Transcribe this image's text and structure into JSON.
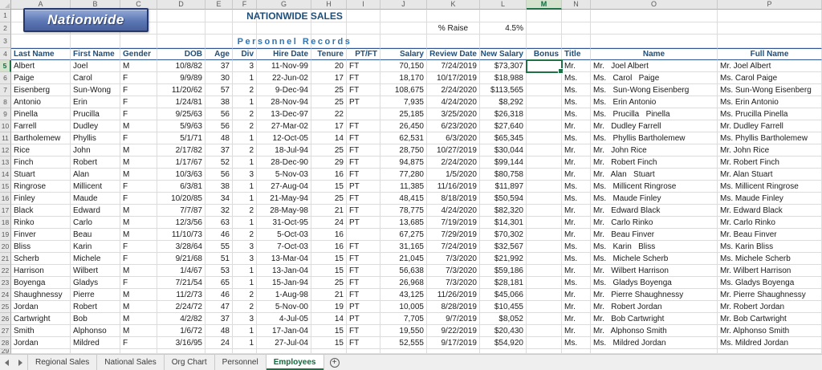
{
  "grid": {
    "column_letters": [
      "A",
      "B",
      "C",
      "D",
      "E",
      "F",
      "G",
      "H",
      "I",
      "J",
      "K",
      "L",
      "M",
      "N",
      "O",
      "P"
    ],
    "selected": {
      "cell": "M5",
      "column": "M",
      "row": 5
    },
    "first_visible_row": 1,
    "last_visible_row": 28
  },
  "workbook": {
    "logo_text": "Nationwide",
    "title": "NATIONWIDE SALES",
    "raise_label": "% Raise",
    "raise_value": "4.5%",
    "section_title": "Personnel Records"
  },
  "table": {
    "headers": [
      "Last Name",
      "First Name",
      "Gender",
      "DOB",
      "Age",
      "Div",
      "Hire Date",
      "Tenure",
      "PT/FT",
      "Salary",
      "Review Date",
      "New Salary",
      "Bonus",
      "Title",
      "Name",
      "Full Name"
    ],
    "rows": [
      [
        "Albert",
        "Joel",
        "M",
        "10/8/82",
        "37",
        "3",
        "11-Nov-99",
        "20",
        "FT",
        "70,150",
        "7/24/2019",
        "$73,307",
        "",
        "Mr.",
        "Mr.   Joel Albert",
        "Mr. Joel Albert"
      ],
      [
        "Paige",
        "Carol",
        "F",
        "9/9/89",
        "30",
        "1",
        "22-Jun-02",
        "17",
        "FT",
        "18,170",
        "10/17/2019",
        "$18,988",
        "",
        "Ms.",
        "Ms.   Carol   Paige",
        "Ms. Carol Paige"
      ],
      [
        "Eisenberg",
        "Sun-Wong",
        "F",
        "11/20/62",
        "57",
        "2",
        "9-Dec-94",
        "25",
        "FT",
        "108,675",
        "2/24/2020",
        "$113,565",
        "",
        "Ms.",
        "Ms.   Sun-Wong Eisenberg",
        "Ms. Sun-Wong Eisenberg"
      ],
      [
        "Antonio",
        "Erin",
        "F",
        "1/24/81",
        "38",
        "1",
        "28-Nov-94",
        "25",
        "PT",
        "7,935",
        "4/24/2020",
        "$8,292",
        "",
        "Ms.",
        "Ms.   Erin Antonio",
        "Ms. Erin Antonio"
      ],
      [
        "Pinella",
        "Prucilla",
        "F",
        "9/25/63",
        "56",
        "2",
        "13-Dec-97",
        "22",
        "",
        "25,185",
        "3/25/2020",
        "$26,318",
        "",
        "Ms.",
        "Ms.   Prucilla   Pinella",
        "Ms. Prucilla Pinella"
      ],
      [
        "Farrell",
        "Dudley",
        "M",
        "5/9/63",
        "56",
        "2",
        "27-Mar-02",
        "17",
        "FT",
        "26,450",
        "6/23/2020",
        "$27,640",
        "",
        "Mr.",
        "Mr.   Dudley Farrell",
        "Mr. Dudley Farrell"
      ],
      [
        "Bartholemew",
        "Phyllis",
        "F",
        "5/1/71",
        "48",
        "1",
        "12-Oct-05",
        "14",
        "FT",
        "62,531",
        "6/3/2020",
        "$65,345",
        "",
        "Ms.",
        "Ms.   Phyllis Bartholemew",
        "Ms. Phyllis Bartholemew"
      ],
      [
        "Rice",
        "John",
        "M",
        "2/17/82",
        "37",
        "2",
        "18-Jul-94",
        "25",
        "FT",
        "28,750",
        "10/27/2019",
        "$30,044",
        "",
        "Mr.",
        "Mr.   John Rice",
        "Mr. John Rice"
      ],
      [
        "Finch",
        "Robert",
        "M",
        "1/17/67",
        "52",
        "1",
        "28-Dec-90",
        "29",
        "FT",
        "94,875",
        "2/24/2020",
        "$99,144",
        "",
        "Mr.",
        "Mr.   Robert Finch",
        "Mr. Robert Finch"
      ],
      [
        "Stuart",
        "Alan",
        "M",
        "10/3/63",
        "56",
        "3",
        "5-Nov-03",
        "16",
        "FT",
        "77,280",
        "1/5/2020",
        "$80,758",
        "",
        "Mr.",
        "Mr.   Alan   Stuart",
        "Mr. Alan Stuart"
      ],
      [
        "Ringrose",
        "Millicent",
        "F",
        "6/3/81",
        "38",
        "1",
        "27-Aug-04",
        "15",
        "PT",
        "11,385",
        "11/16/2019",
        "$11,897",
        "",
        "Ms.",
        "Ms.   Millicent Ringrose",
        "Ms. Millicent Ringrose"
      ],
      [
        "Finley",
        "Maude",
        "F",
        "10/20/85",
        "34",
        "1",
        "21-May-94",
        "25",
        "FT",
        "48,415",
        "8/18/2019",
        "$50,594",
        "",
        "Ms.",
        "Ms.   Maude Finley",
        "Ms. Maude Finley"
      ],
      [
        "Black",
        "Edward",
        "M",
        "7/7/87",
        "32",
        "2",
        "28-May-98",
        "21",
        "FT",
        "78,775",
        "4/24/2020",
        "$82,320",
        "",
        "Mr.",
        "Mr.   Edward Black",
        "Mr. Edward Black"
      ],
      [
        "Rinko",
        "Carlo",
        "M",
        "12/3/56",
        "63",
        "1",
        "31-Oct-95",
        "24",
        "PT",
        "13,685",
        "7/19/2019",
        "$14,301",
        "",
        "Mr.",
        "Mr.   Carlo Rinko",
        "Mr. Carlo Rinko"
      ],
      [
        "Finver",
        "Beau",
        "M",
        "11/10/73",
        "46",
        "2",
        "5-Oct-03",
        "16",
        "",
        "67,275",
        "7/29/2019",
        "$70,302",
        "",
        "Mr.",
        "Mr.   Beau Finver",
        "Mr. Beau Finver"
      ],
      [
        "Bliss",
        "Karin",
        "F",
        "3/28/64",
        "55",
        "3",
        "7-Oct-03",
        "16",
        "FT",
        "31,165",
        "7/24/2019",
        "$32,567",
        "",
        "Ms.",
        "Ms.   Karin   Bliss",
        "Ms. Karin Bliss"
      ],
      [
        "Scherb",
        "Michele",
        "F",
        "9/21/68",
        "51",
        "3",
        "13-Mar-04",
        "15",
        "FT",
        "21,045",
        "7/3/2020",
        "$21,992",
        "",
        "Ms.",
        "Ms.   Michele Scherb",
        "Ms. Michele Scherb"
      ],
      [
        "Harrison",
        "Wilbert",
        "M",
        "1/4/67",
        "53",
        "1",
        "13-Jan-04",
        "15",
        "FT",
        "56,638",
        "7/3/2020",
        "$59,186",
        "",
        "Mr.",
        "Mr.   Wilbert Harrison",
        "Mr. Wilbert Harrison"
      ],
      [
        "Boyenga",
        "Gladys",
        "F",
        "7/21/54",
        "65",
        "1",
        "15-Jan-94",
        "25",
        "FT",
        "26,968",
        "7/3/2020",
        "$28,181",
        "",
        "Ms.",
        "Ms.   Gladys Boyenga",
        "Ms. Gladys Boyenga"
      ],
      [
        "Shaughnessy",
        "Pierre",
        "M",
        "11/2/73",
        "46",
        "2",
        "1-Aug-98",
        "21",
        "FT",
        "43,125",
        "11/26/2019",
        "$45,066",
        "",
        "Mr.",
        "Mr.   Pierre Shaughnessy",
        "Mr. Pierre Shaughnessy"
      ],
      [
        "Jordan",
        "Robert",
        "M",
        "2/24/72",
        "47",
        "2",
        "5-Nov-00",
        "19",
        "PT",
        "10,005",
        "8/28/2019",
        "$10,455",
        "",
        "Mr.",
        "Mr.   Robert Jordan",
        "Mr. Robert Jordan"
      ],
      [
        "Cartwright",
        "Bob",
        "M",
        "4/2/82",
        "37",
        "3",
        "4-Jul-05",
        "14",
        "PT",
        "7,705",
        "9/7/2019",
        "$8,052",
        "",
        "Mr.",
        "Mr.   Bob Cartwright",
        "Mr. Bob Cartwright"
      ],
      [
        "Smith",
        "Alphonso",
        "M",
        "1/6/72",
        "48",
        "1",
        "17-Jan-04",
        "15",
        "FT",
        "19,550",
        "9/22/2019",
        "$20,430",
        "",
        "Mr.",
        "Mr.   Alphonso Smith",
        "Mr. Alphonso Smith"
      ],
      [
        "Jordan",
        "Mildred",
        "F",
        "3/16/95",
        "24",
        "1",
        "27-Jul-04",
        "15",
        "FT",
        "52,555",
        "9/17/2019",
        "$54,920",
        "",
        "Ms.",
        "Ms.   Mildred Jordan",
        "Ms. Mildred Jordan"
      ]
    ]
  },
  "sheet_tabs": {
    "tabs": [
      "Regional Sales",
      "National Sales",
      "Org Chart",
      "Personnel",
      "Employees"
    ],
    "active_tab": "Employees",
    "new_sheet_label": "+"
  },
  "colors": {
    "selection_green": "#1E7145",
    "heading_blue": "#1F4E79",
    "section_blue": "#2E75B6",
    "logo_blue": "#5C77B5"
  }
}
